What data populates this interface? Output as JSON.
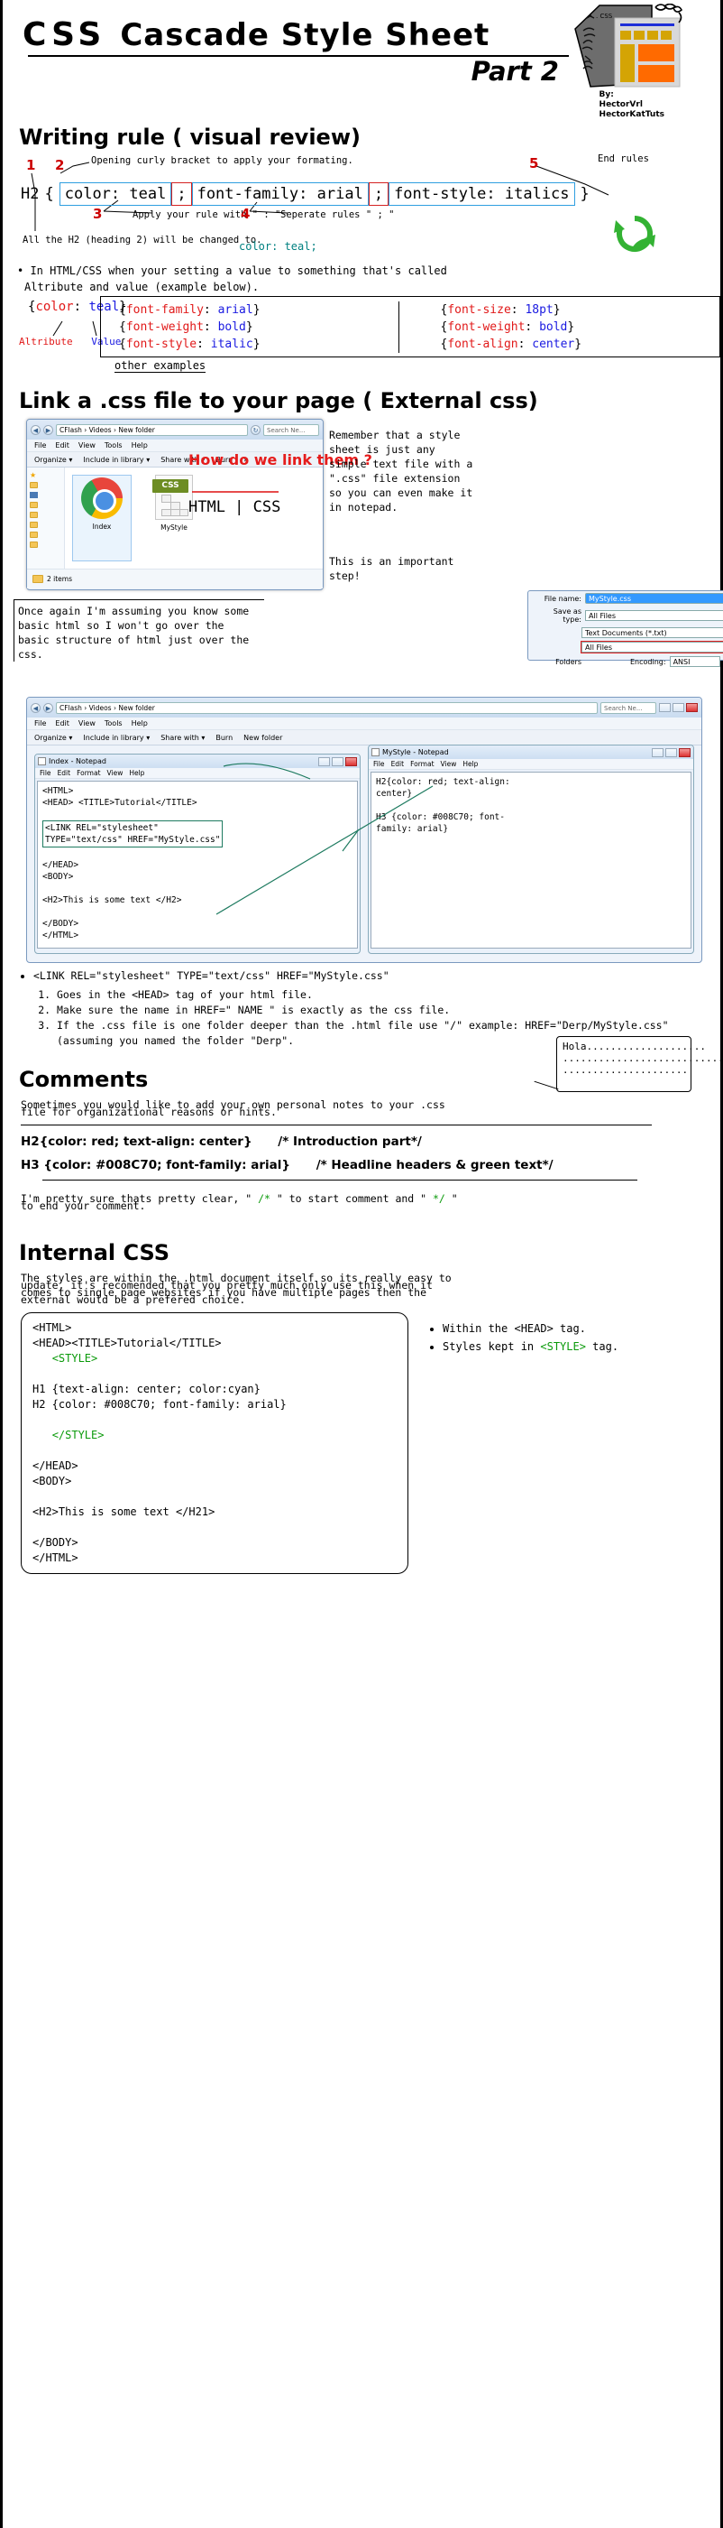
{
  "header": {
    "title_css": "CSS",
    "title_rest": "Cascade Style Sheet",
    "part": "Part 2",
    "by_label": "By:",
    "author1": "HectorVrl",
    "author2": "HectorKatTuts"
  },
  "section1": {
    "heading": "Writing rule ( visual review)",
    "ann1": "1",
    "ann2": "2",
    "ann3": "3",
    "ann4": "4",
    "ann5": "5",
    "ann2_text": "Opening curly bracket to apply your formating.",
    "ann3_text": "Apply your rule with \" : \"",
    "ann4_text": "Seperate rules \" ; \"",
    "ann5_text": "End rules",
    "selector": "H2",
    "open_brace": "{",
    "close_brace": "}",
    "decl1": "color: teal",
    "decl2": "font-family: arial",
    "decl3": "font-style: italics",
    "semi1": ";",
    "semi2": ";",
    "all_h2_note": "All the H2 (heading 2) will be changed to.",
    "result_text": "color: teal;"
  },
  "attrvalue": {
    "bullet": "• In HTML/CSS when your setting a value to something that's called",
    "bullet_line2": "Altribute and value (example below).",
    "example_open": "{",
    "example_attr": "color",
    "example_colon": ": ",
    "example_value": "teal",
    "example_close": "}",
    "label_attr": "Altribute",
    "label_value": "Value",
    "col1": [
      {
        "attr": "font-family",
        "value": "arial"
      },
      {
        "attr": "font-weight",
        "value": "bold"
      },
      {
        "attr": "font-style",
        "value": "italic"
      }
    ],
    "col2": [
      {
        "attr": "font-size",
        "value": "18pt"
      },
      {
        "attr": "font-weight",
        "value": "bold"
      },
      {
        "attr": "font-align",
        "value": "center"
      }
    ],
    "other_examples": "other examples"
  },
  "section2": {
    "heading": "Link a .css file to your page ( External css)",
    "explorer": {
      "address": "CFlash  ›  Videos  ›  New folder",
      "search_placeholder": "Search Ne...",
      "menu": [
        "File",
        "Edit",
        "View",
        "Tools",
        "Help"
      ],
      "toolbar": [
        "Organize ▾",
        "Include in library ▾",
        "Share with ▾",
        "Burn",
        "»"
      ],
      "file1": "Index",
      "file2": "MyStyle",
      "css_badge": "CSS",
      "status": "2 items"
    },
    "how_link": "How do we link them ?",
    "html_css": "HTML | CSS",
    "remember": "Remember that a style sheet is just any simple text file with a \".css\" file extension so you can even make it in notepad.",
    "important": "This is an important step!"
  },
  "savedialog": {
    "filename_label": "File name:",
    "filename_value": "MyStyle.css",
    "savetype_label": "Save as type:",
    "savetype_value": "All Files",
    "opt1": "Text Documents (*.txt)",
    "opt2": "All Files",
    "folders_label": "Folders",
    "encoding_label": "Encoding:",
    "encoding_value": "ANSI"
  },
  "assume_text": "Once again I'm assuming you know some basic html so I won't go over the basic structure of html just over the css.",
  "bigwindow": {
    "address": "CFlash  ›  Videos  ›  New folder",
    "search_placeholder": "Search Ne...",
    "menu": [
      "File",
      "Edit",
      "View",
      "Tools",
      "Help"
    ],
    "toolbar": [
      "Organize ▾",
      "Include in library ▾",
      "Share with ▾",
      "Burn",
      "New folder"
    ],
    "tab_label": "Index - Notepad",
    "notepad1": {
      "title": "Index - Notepad",
      "menu": [
        "File",
        "Edit",
        "Format",
        "View",
        "Help"
      ],
      "line1": "<HTML>",
      "line2": "<HEAD> <TITLE>Tutorial</TITLE>",
      "link1": "<LINK REL=\"stylesheet\"",
      "link2": "TYPE=\"text/css\" HREF=\"MyStyle.css\"",
      "body": "</HEAD>\n<BODY>\n\n<H2>This is some text </H2>\n\n</BODY>\n</HTML>"
    },
    "notepad2": {
      "title": "MyStyle - Notepad",
      "menu": [
        "File",
        "Edit",
        "Format",
        "View",
        "Help"
      ],
      "code": "H2{color: red; text-align:\ncenter}\n\nH3 {color: #008C70; font-\nfamily: arial}"
    }
  },
  "linkinfo": {
    "bullet": "<LINK REL=\"stylesheet\" TYPE=\"text/css\" HREF=\"MyStyle.css\"",
    "steps": [
      "Goes in the <HEAD> tag of your html file.",
      "Make sure the name in HREF=\" NAME \" is exactly as the css file.",
      "If the .css file is one folder deeper than the .html file use \"/\"  example:  HREF=\"Derp/MyStyle.css\" (assuming you named the folder \"Derp\"."
    ]
  },
  "comments": {
    "heading": "Comments",
    "hola": "Hola....................\n............................\n.....................",
    "intro_1": "Sometimes you would like to add your own personal notes to your .css",
    "intro_2": "file for organizational reasons or hints.",
    "example1": "H2{color: red; text-align: center}",
    "example1_cmt": "/* Introduction part*/",
    "example2": "H3 {color: #008C70; font-family: arial}",
    "example2_cmt": "/* Headline headers & green text*/",
    "closing_a": "I'm pretty sure thats pretty clear, \" ",
    "closing_start": "/*",
    "closing_b": " \" to start comment and \" ",
    "closing_end": "*/",
    "closing_c": " \"",
    "closing_d": "to end your comment."
  },
  "internal": {
    "heading": "Internal CSS",
    "para1": "The styles are within the .html document itself so its really easy to",
    "para2": "update, it's recomended that you pretty much only use this when it",
    "para3": "comes to single page websites if you have multiple pages then the",
    "para4": "external would be a prefered choice.",
    "code_l1": "<HTML>",
    "code_l2": "<HEAD><TITLE>Tutorial</TITLE>",
    "code_style_open": "<STYLE>",
    "code_h1": "H1 {text-align: center; color:cyan}",
    "code_h2": "H2 {color: #008C70; font-family: arial}",
    "code_style_close": "</STYLE>",
    "code_l3": "</HEAD>",
    "code_l4": "<BODY>",
    "code_l5": "<H2>This is some text </H21>",
    "code_l6": "</BODY>",
    "code_l7": "</HTML>",
    "note1": "Within the <HEAD> tag.",
    "note2_a": "Styles kept in ",
    "note2_style": "<STYLE>",
    "note2_b": " tag."
  },
  "colors": {
    "red": "#e11919",
    "blue": "#1a1ae1",
    "green": "#0a9a0a",
    "teal": "#008080",
    "annotation_red": "#cc0000",
    "box_blue": "#2f9fe0"
  }
}
